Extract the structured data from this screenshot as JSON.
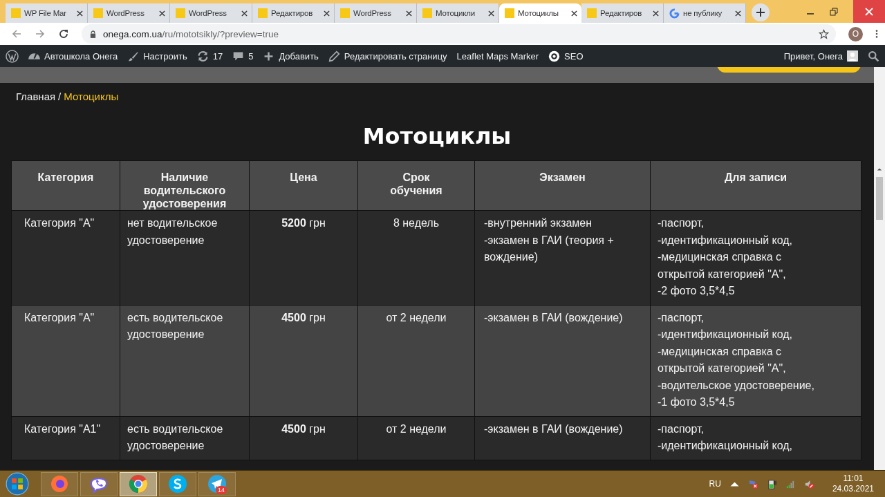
{
  "browser": {
    "tabs": [
      {
        "title": "WP File Mar",
        "kind": "site",
        "selected": false
      },
      {
        "title": "WordPress",
        "kind": "site",
        "selected": false
      },
      {
        "title": "WordPress",
        "kind": "site",
        "selected": false
      },
      {
        "title": "Редактиров",
        "kind": "site",
        "selected": false
      },
      {
        "title": "WordPress",
        "kind": "site",
        "selected": false
      },
      {
        "title": "Мотоцикли",
        "kind": "site",
        "selected": false
      },
      {
        "title": "Мотоциклы",
        "kind": "site",
        "selected": true
      },
      {
        "title": "Редактиров",
        "kind": "site",
        "selected": false
      },
      {
        "title": "не публику",
        "kind": "google",
        "selected": false
      }
    ],
    "address": {
      "domain": "onega.com.ua",
      "path": "/ru/mototsikly/?preview=true"
    },
    "profile_initial": "О"
  },
  "admin_bar": {
    "items": [
      {
        "kind": "wordpress"
      },
      {
        "kind": "dashboard",
        "label": "Автошкола Онега"
      },
      {
        "kind": "brush",
        "label": "Настроить"
      },
      {
        "kind": "updates",
        "label": "17"
      },
      {
        "kind": "comments",
        "label": "5"
      },
      {
        "kind": "add",
        "label": "Добавить"
      },
      {
        "kind": "edit",
        "label": "Редактировать страницу"
      },
      {
        "kind": "text",
        "label": "Leaflet Maps Marker"
      },
      {
        "kind": "seo",
        "label": "SEO"
      }
    ],
    "greeting": "Привет, Онега"
  },
  "breadcrumb": {
    "home": "Главная",
    "separator": "/",
    "current": "Мотоциклы"
  },
  "page_title": "Мотоциклы",
  "table": {
    "columns": [
      "Категория",
      "Наличие водительского удостоверения",
      "Цена",
      "Срок обучения",
      "Экзамен",
      "Для записи"
    ],
    "rows": [
      {
        "cells": [
          [
            "Категория \"А\""
          ],
          [
            "нет водительское",
            "удостоверение"
          ],
          [
            "**5200** грн"
          ],
          [
            "8 недель"
          ],
          [
            "-внутренний экзамен",
            "-экзамен в ГАИ (теория +",
            "вождение)"
          ],
          [
            "-паспорт,",
            "-идентификационный код,",
            "-медицинская справка с",
            "открытой категорией \"А\",",
            "-2 фото 3,5*4,5"
          ]
        ]
      },
      {
        "cells": [
          [
            "Категория \"А\""
          ],
          [
            "есть водительское",
            "удостоверение"
          ],
          [
            "**4500** грн"
          ],
          [
            "от 2 недели"
          ],
          [
            "-экзамен в ГАИ (вождение)"
          ],
          [
            "-паспорт,",
            "-идентификационный код,",
            "-медицинская  справка с",
            "открытой категорией \"А\",",
            "-водительское удостоверение,",
            "-1 фото 3,5*4,5"
          ]
        ]
      },
      {
        "cells": [
          [
            "Категория \"А1\""
          ],
          [
            "есть водительское",
            "удостоверение"
          ],
          [
            "**4500** грн"
          ],
          [
            "от 2 недели"
          ],
          [
            "-экзамен в ГАИ (вождение)"
          ],
          [
            "-паспорт,",
            "-идентификационный код,"
          ]
        ]
      }
    ]
  },
  "taskbar": {
    "apps": [
      {
        "kind": "firefox",
        "selected": false
      },
      {
        "kind": "viber",
        "selected": false
      },
      {
        "kind": "chrome",
        "selected": true
      },
      {
        "kind": "skype",
        "selected": false
      },
      {
        "kind": "telegram",
        "selected": false,
        "badge": "14"
      }
    ],
    "language": "RU",
    "time": "11:01",
    "date": "24.03.2021"
  }
}
